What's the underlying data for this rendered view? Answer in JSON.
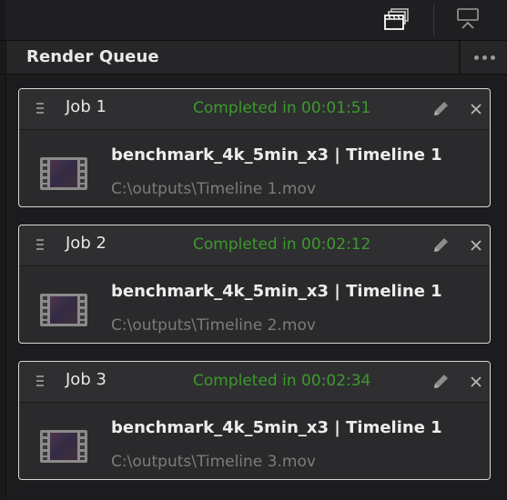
{
  "toolbar": {
    "icons": [
      "render-queue-icon",
      "output-icon"
    ]
  },
  "panel": {
    "title": "Render Queue",
    "more_icon": "ellipsis-icon"
  },
  "jobs": [
    {
      "label": "Job 1",
      "status": "Completed in 00:01:51",
      "name": "benchmark_4k_5min_x3 | Timeline 1",
      "path": "C:\\outputs\\Timeline 1.mov"
    },
    {
      "label": "Job 2",
      "status": "Completed in 00:02:12",
      "name": "benchmark_4k_5min_x3 | Timeline 1",
      "path": "C:\\outputs\\Timeline 2.mov"
    },
    {
      "label": "Job 3",
      "status": "Completed in 00:02:34",
      "name": "benchmark_4k_5min_x3 | Timeline 1",
      "path": "C:\\outputs\\Timeline 3.mov"
    }
  ],
  "colors": {
    "status_completed": "#3c9a2c",
    "card_border": "#d8d8d8",
    "background": "#1c1c1e"
  }
}
